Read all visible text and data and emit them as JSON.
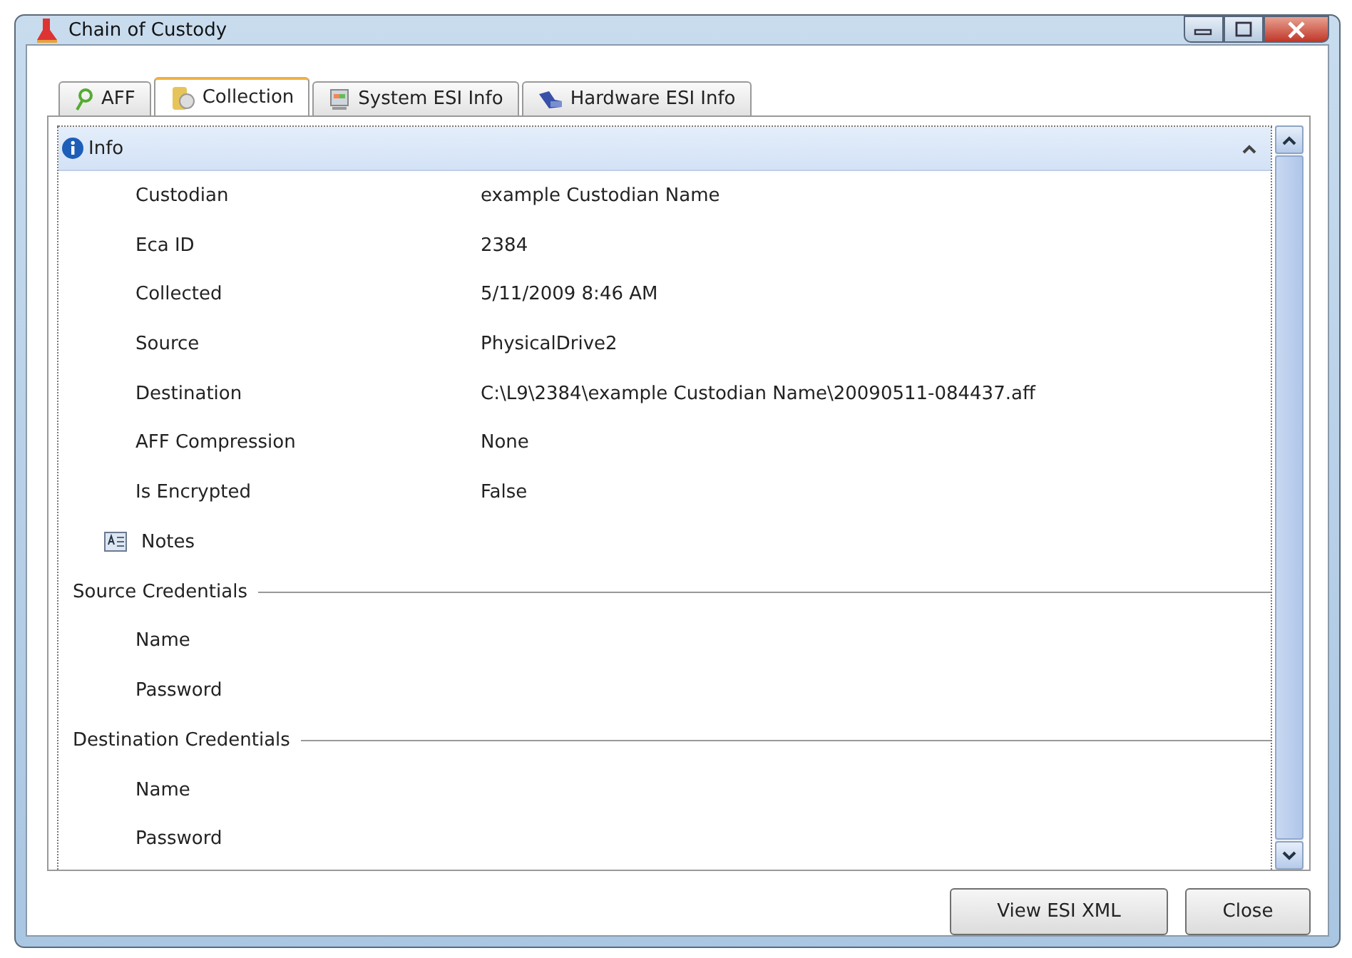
{
  "window": {
    "title": "Chain of Custody"
  },
  "tabs": [
    {
      "label": "AFF",
      "selected": false
    },
    {
      "label": "Collection",
      "selected": true
    },
    {
      "label": "System ESI Info",
      "selected": false
    },
    {
      "label": "Hardware ESI Info",
      "selected": false
    }
  ],
  "info_section": {
    "title": "Info",
    "expanded": true
  },
  "properties": [
    {
      "label": "Custodian",
      "value": "example Custodian Name"
    },
    {
      "label": "Eca ID",
      "value": "2384"
    },
    {
      "label": "Collected",
      "value": "5/11/2009 8:46 AM"
    },
    {
      "label": "Source",
      "value": "PhysicalDrive2"
    },
    {
      "label": "Destination",
      "value": "C:\\L9\\2384\\example Custodian Name\\20090511-084437.aff"
    },
    {
      "label": "AFF Compression",
      "value": "None"
    },
    {
      "label": "Is Encrypted",
      "value": "False"
    }
  ],
  "notes": {
    "label": "Notes"
  },
  "groups": [
    {
      "title": "Source Credentials",
      "fields": [
        "Name",
        "Password"
      ]
    },
    {
      "title": "Destination Credentials",
      "fields": [
        "Name",
        "Password"
      ]
    }
  ],
  "buttons": [
    "View ESI XML",
    "Close"
  ]
}
